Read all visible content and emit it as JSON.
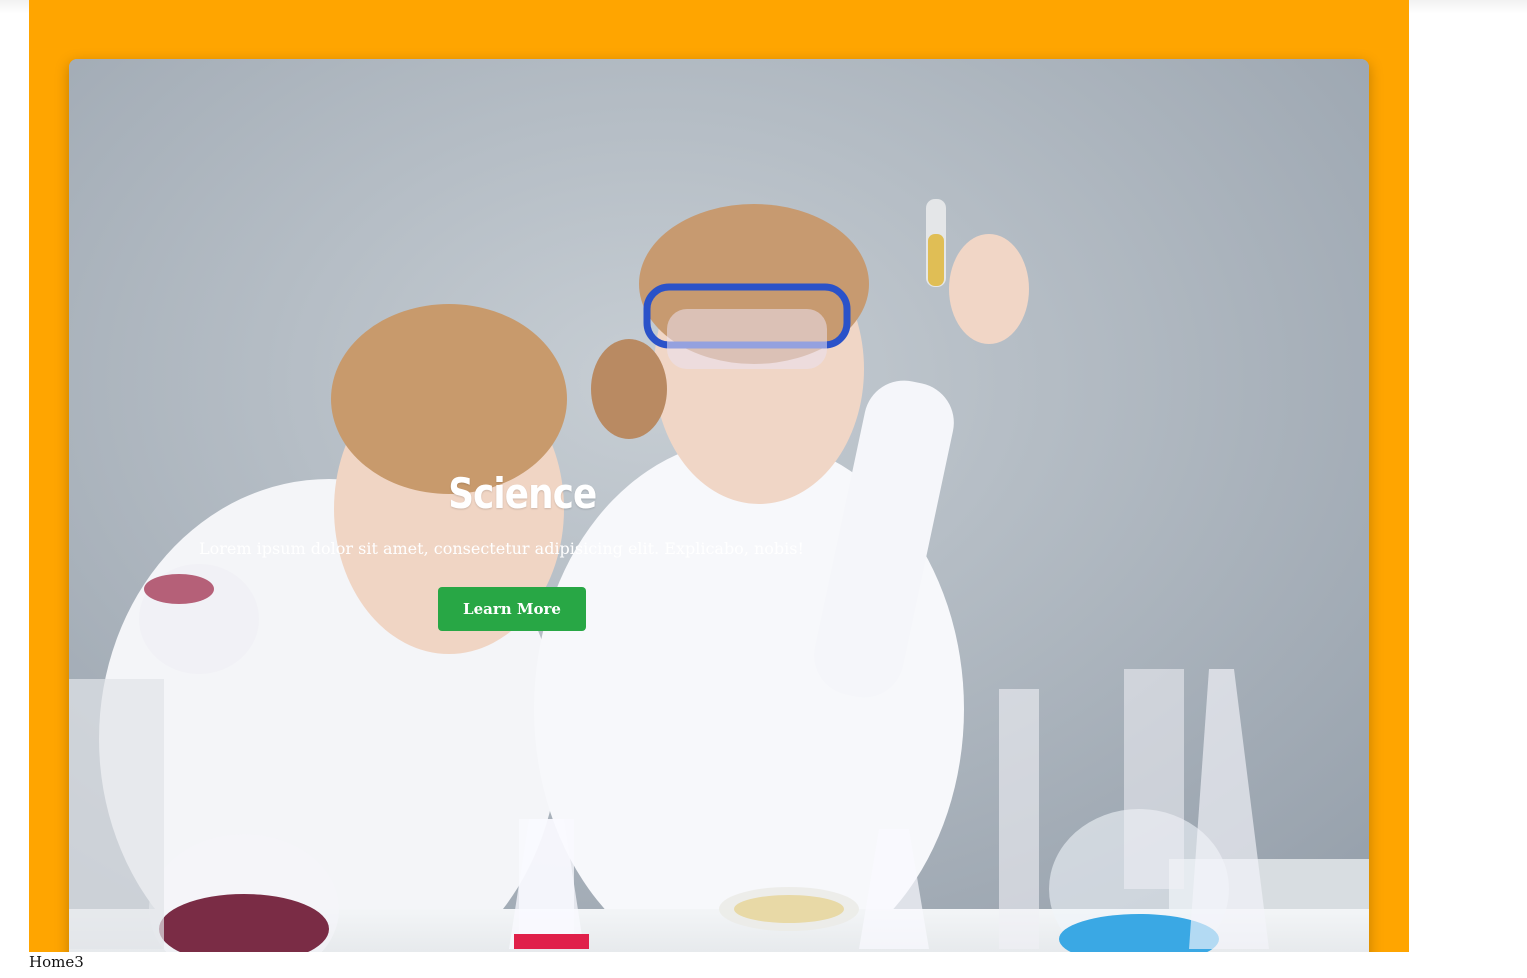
{
  "hero": {
    "title": "Science",
    "text": "Lorem ipsum dolor sit amet, consectetur adipisicing elit. Explicabo, nobis!",
    "button_label": "Learn More"
  },
  "footer": {
    "label": "Home3"
  },
  "colors": {
    "frame": "#ffa500",
    "button": "#28a745",
    "background": "#ffffff"
  }
}
